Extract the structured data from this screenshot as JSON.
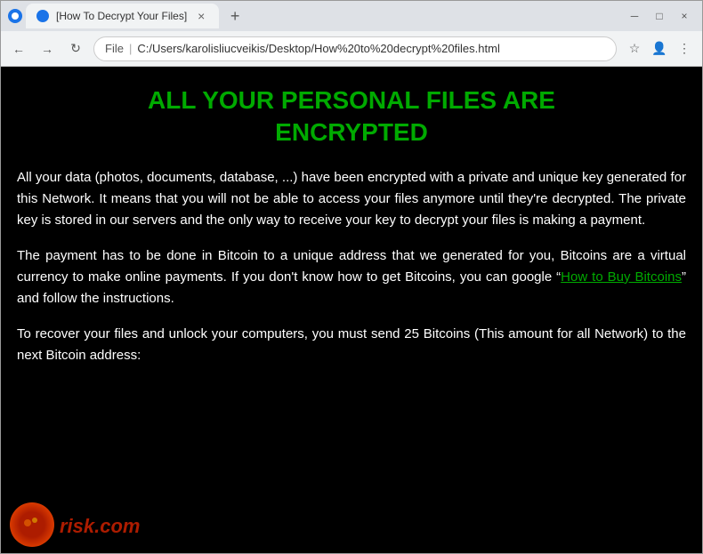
{
  "browser": {
    "tab_title": "[How To Decrypt Your Files]",
    "new_tab_label": "+",
    "back_icon": "←",
    "forward_icon": "→",
    "refresh_icon": "↻",
    "shield_icon": "🛡",
    "scheme": "File",
    "separator": "|",
    "url": "C:/Users/karolisliucveikis/Desktop/How%20to%20decrypt%20files.html",
    "star_icon": "☆",
    "profile_icon": "👤",
    "menu_icon": "⋮",
    "minimize_icon": "─",
    "maximize_icon": "□",
    "close_icon": "×"
  },
  "page": {
    "title": "ALL YOUR PERSONAL FILES ARE\nENCRYPTED",
    "paragraph1": "All your data (photos, documents, database, ...) have been encrypted with a private and unique key generated for this Network. It means that you will not be able to access your files anymore until they're decrypted. The private key is stored in our servers and the only way to receive your key to decrypt your files is making a payment.",
    "paragraph2_part1": "The payment has to be done in Bitcoin to a unique address that we generated for you, Bitcoins are a virtual currency to make online payments. If you don't know how to get Bitcoins, you can google “",
    "paragraph2_link": "How to Buy Bitcoins",
    "paragraph2_part2": "” and follow the instructions.",
    "paragraph3": "To recover your files and unlock your computers, you must send 25 Bitcoins (This amount for all Network) to the next Bitcoin address:"
  },
  "watermark": {
    "text": "risk.com"
  }
}
